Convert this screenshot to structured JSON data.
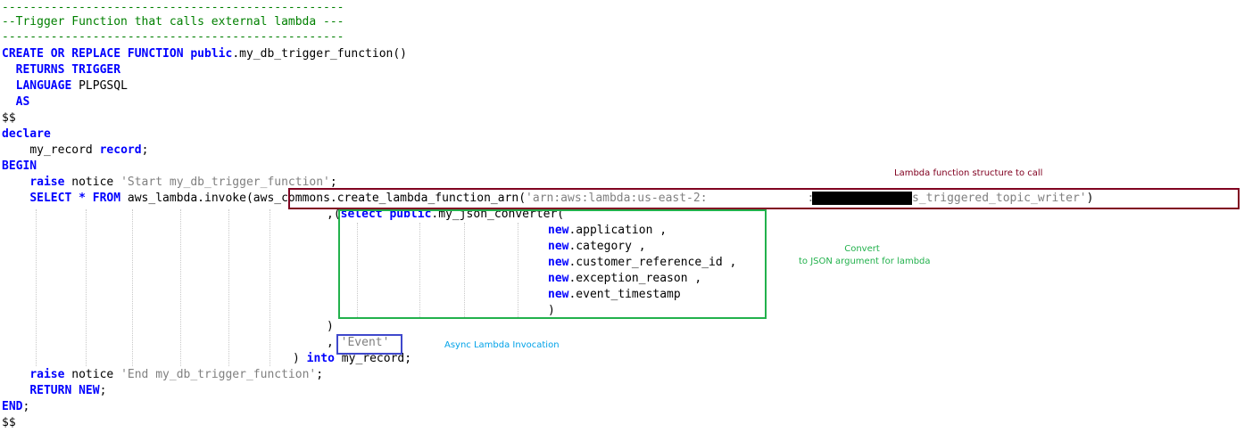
{
  "code": {
    "sep_top": "-------------------------------------------------",
    "comment": "--Trigger Function that calls external lambda ---",
    "sep_bottom": "-------------------------------------------------",
    "l4_kw1": "CREATE",
    "l4_kw2": "OR",
    "l4_kw3": "REPLACE",
    "l4_kw4": "FUNCTION",
    "l4_schema": "public",
    "l4_rest": ".my_db_trigger_function()",
    "l5_kw1": "RETURNS",
    "l5_kw2": "TRIGGER",
    "l6_kw": "LANGUAGE",
    "l6_val": "PLPGSQL",
    "l7_kw": "AS",
    "l8": "$$",
    "l9_kw": "declare",
    "l10_var": "my_record",
    "l10_type": "record",
    "l10_end": ";",
    "l11_kw": "BEGIN",
    "l12_kw": "raise",
    "l12_txt": "notice",
    "l12_str": "'Start my_db_trigger_function'",
    "l12_end": ";",
    "l13_kw1": "SELECT",
    "l13_star": "*",
    "l13_kw2": "FROM",
    "l13_fn": "aws_lambda.invoke(",
    "l13_arnfn": "aws_commons.create_lambda_function_arn(",
    "l13_str1": "'arn:aws:lambda:us-east-2:",
    "l13_str2": ":function:my_rds_triggered_topic_writer'",
    "l13_close": ")",
    "l14_pre": ",(",
    "l14_kw1": "select",
    "l14_kw2": "public",
    "l14_rest": ".my_json_converter(",
    "new_kw": "new",
    "arg1": ".application ,",
    "arg2": ".category ,",
    "arg3": ".customer_reference_id ,",
    "arg4": ".exception_reason ,",
    "arg5": ".event_timestamp",
    "l20": ")",
    "l21": ")",
    "l22_comma": ",",
    "l22_str": "'Event'",
    "l23_paren": ")",
    "l23_kw": "into",
    "l23_var": "my_record;",
    "l24_kw": "raise",
    "l24_txt": "notice",
    "l24_str": "'End my_db_trigger_function'",
    "l24_end": ";",
    "l25_kw1": "RETURN",
    "l25_kw2": "NEW",
    "l25_end": ";",
    "l26_kw": "END",
    "l26_end": ";",
    "l27": "$$"
  },
  "annotations": {
    "lambda_structure": "Lambda function structure to call",
    "convert": "Convert\nto JSON argument for lambda",
    "async": "Async Lambda Invocation"
  },
  "colors": {
    "keyword": "#0000ff",
    "string": "#808080",
    "comment": "#008000",
    "box_red": "#800020",
    "box_green": "#22b14c",
    "box_blue": "#3f48cc",
    "note_red": "#800020",
    "note_green": "#22b14c",
    "note_blue": "#00a2e8"
  }
}
